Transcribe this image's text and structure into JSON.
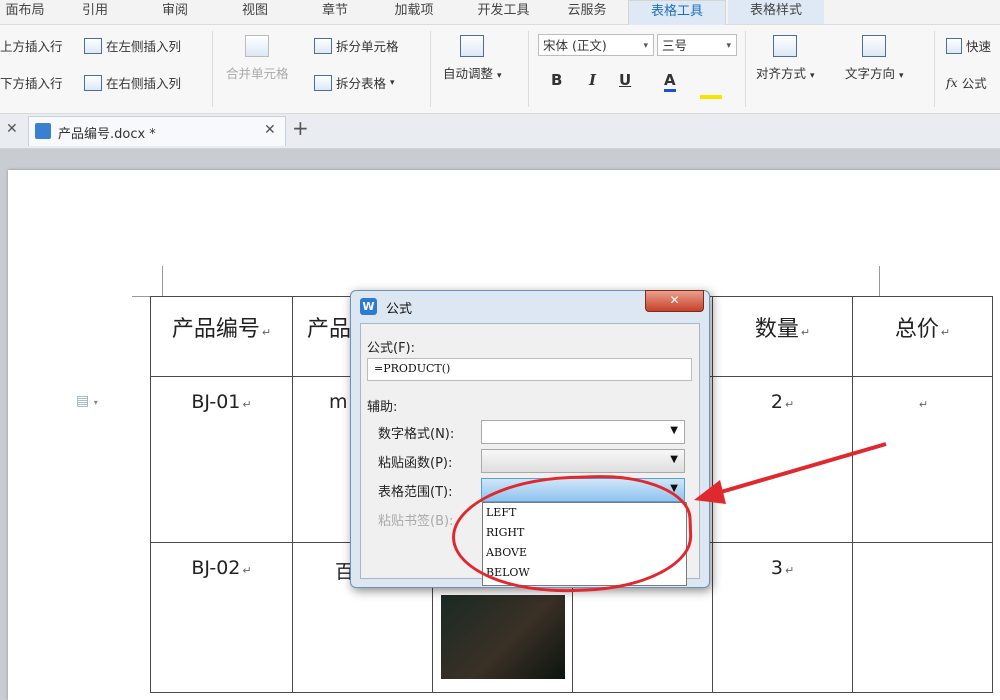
{
  "ribbon_tabs": [
    "面布局",
    "引用",
    "审阅",
    "视图",
    "章节",
    "加载项",
    "开发工具",
    "云服务",
    "表格工具",
    "表格样式"
  ],
  "ribbon": {
    "insert_above_row": "上方插入行",
    "insert_left_col": "在左侧插入列",
    "insert_below_row": "下方插入行",
    "insert_right_col": "在右侧插入列",
    "merge_cells": "合并单元格",
    "split_cells": "拆分单元格",
    "split_table": "拆分表格",
    "auto_fit": "自动调整",
    "font_name": "宋体 (正文)",
    "font_size": "三号",
    "bold": "B",
    "italic": "I",
    "underline": "U",
    "font_color": "A",
    "align": "对齐方式",
    "text_direction": "文字方向",
    "quick_calc": "快速",
    "formula": "公式"
  },
  "doc_tab": {
    "name": "产品编号.docx *"
  },
  "table": {
    "headers": [
      "产品编号",
      "产品",
      "",
      "",
      "数量",
      "总价"
    ],
    "rows": [
      [
        "BJ-01",
        "m",
        "",
        "",
        "2",
        ""
      ],
      [
        "BJ-02",
        "百",
        "",
        "",
        "3",
        ""
      ]
    ]
  },
  "dialog": {
    "title": "公式",
    "formula_label": "公式(F):",
    "formula_value": "=PRODUCT()",
    "assist_label": "辅助:",
    "number_format_label": "数字格式(N):",
    "paste_function_label": "粘贴函数(P):",
    "table_range_label": "表格范围(T):",
    "paste_bookmark_label": "粘贴书签(B):",
    "range_options": [
      "LEFT",
      "RIGHT",
      "ABOVE",
      "BELOW"
    ]
  },
  "colors": {
    "annotation_red": "#e0282e",
    "accent_blue": "#1e6fbd"
  }
}
